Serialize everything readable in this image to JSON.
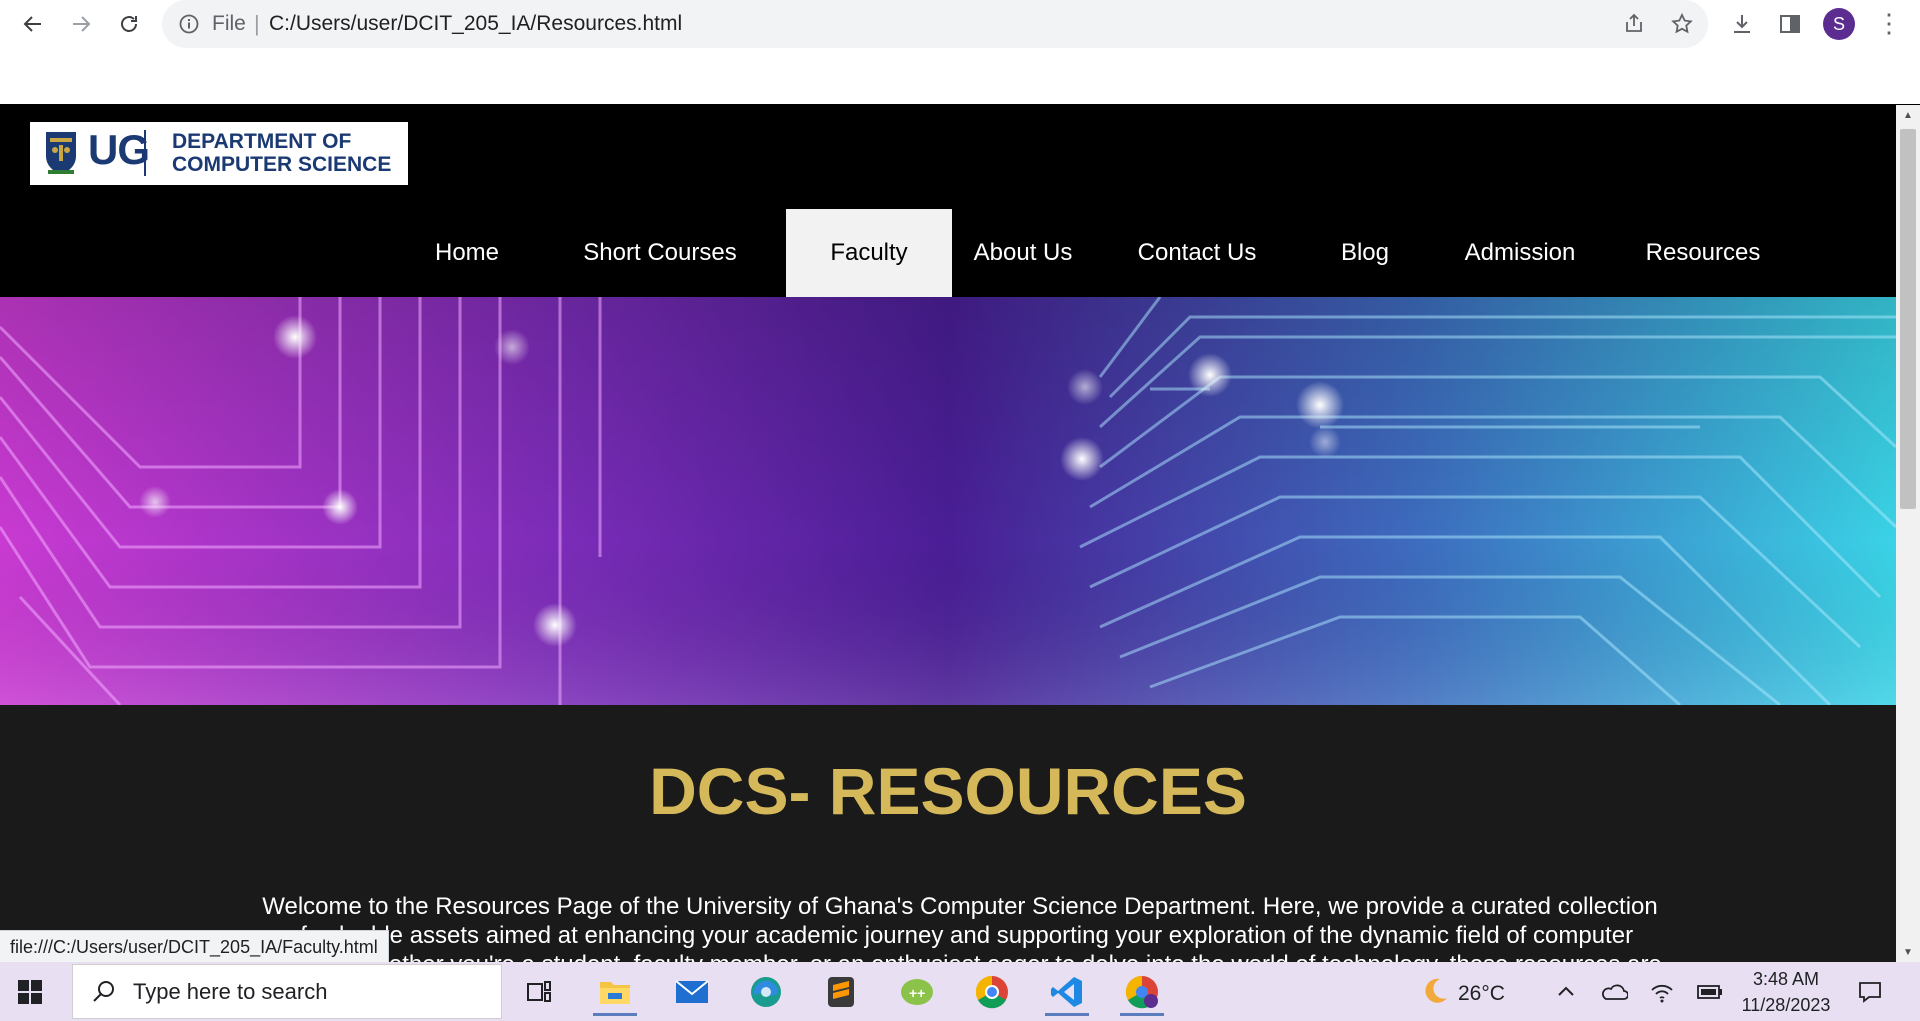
{
  "browser": {
    "file_label": "File",
    "separator": "|",
    "url": "C:/Users/user/DCIT_205_IA/Resources.html",
    "avatar_initial": "S",
    "status_url": "file:///C:/Users/user/DCIT_205_IA/Faculty.html"
  },
  "logo": {
    "ug": "UG",
    "line1": "DEPARTMENT OF",
    "line2": "COMPUTER SCIENCE"
  },
  "nav": {
    "items": [
      {
        "label": "Home",
        "active": false
      },
      {
        "label": "Short Courses",
        "active": false
      },
      {
        "label": "Faculty",
        "active": true
      },
      {
        "label": "About Us",
        "active": false
      },
      {
        "label": "Contact Us",
        "active": false
      },
      {
        "label": "Blog",
        "active": false
      },
      {
        "label": "Admission",
        "active": false
      },
      {
        "label": "Resources",
        "active": false
      }
    ]
  },
  "main": {
    "title": "DCS- RESOURCES",
    "intro": "Welcome to the Resources Page of the University of Ghana's Computer Science Department. Here, we provide a curated collection of valuable assets aimed at enhancing your academic journey and supporting your exploration of the dynamic field of computer science. Whether you're a student, faculty member, or an enthusiast eager to delve into the world of technology, these resources are designed to"
  },
  "taskbar": {
    "search_placeholder": "Type here to search",
    "weather": "26°C",
    "time": "3:48 AM",
    "date": "11/28/2023"
  },
  "colors": {
    "title_gold": "#d4b85a",
    "header_bg": "#000000",
    "content_bg": "#1a1a1a",
    "active_tab_bg": "#f2f2f2",
    "logo_blue": "#1b3a73"
  }
}
